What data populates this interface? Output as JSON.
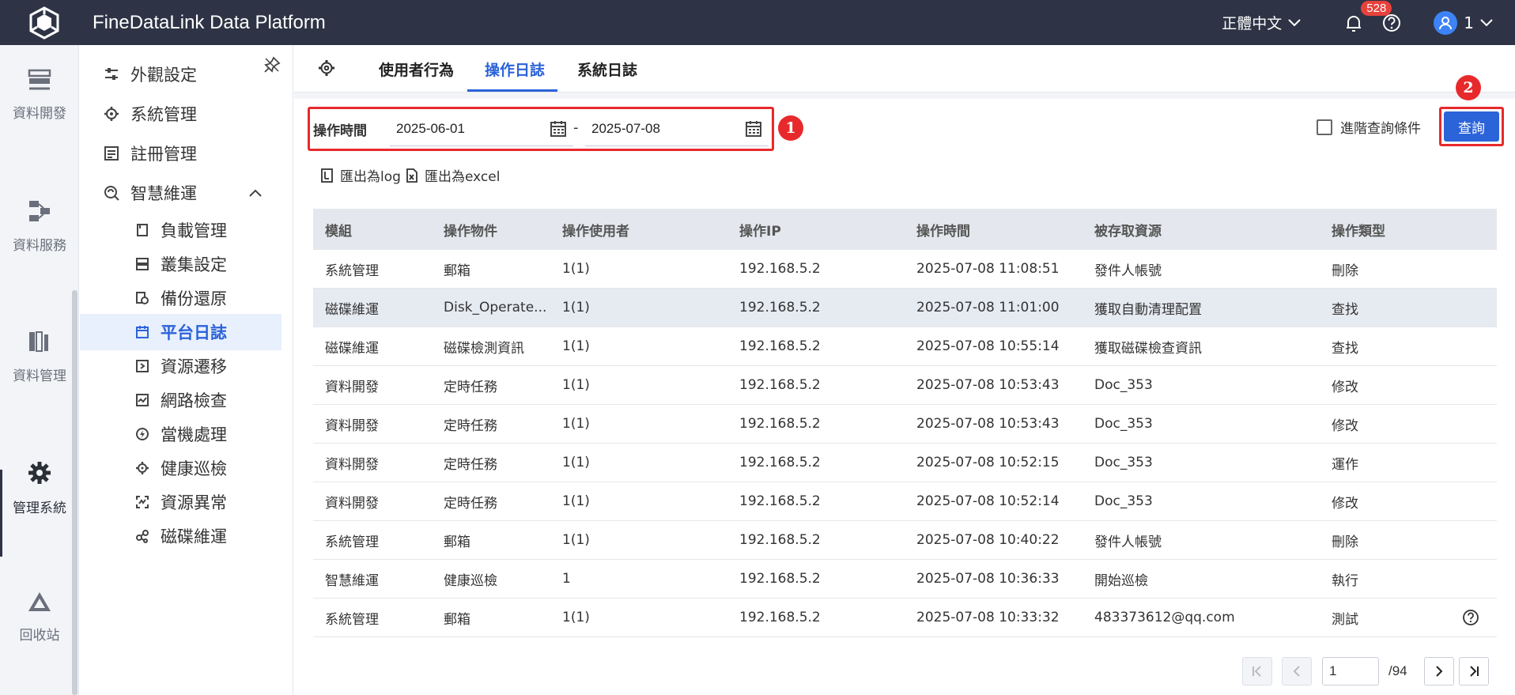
{
  "app": {
    "title": "FineDataLink Data Platform"
  },
  "topbar": {
    "language": "正體中文",
    "notification_count": "528",
    "user_name": "1"
  },
  "rail": {
    "items": [
      {
        "label": "資料開發",
        "icon": "data-dev-icon"
      },
      {
        "label": "資料服務",
        "icon": "data-service-icon"
      },
      {
        "label": "資料管理",
        "icon": "data-manage-icon"
      },
      {
        "label": "管理系統",
        "icon": "gear-icon",
        "active": true
      },
      {
        "label": "回收站",
        "icon": "recycle-icon"
      }
    ]
  },
  "sidebar": {
    "items": [
      {
        "label": "外觀設定"
      },
      {
        "label": "系統管理"
      },
      {
        "label": "註冊管理"
      },
      {
        "label": "智慧維運",
        "expanded": true
      }
    ],
    "sub_items": [
      {
        "label": "負載管理"
      },
      {
        "label": "叢集設定"
      },
      {
        "label": "備份還原"
      },
      {
        "label": "平台日誌",
        "active": true
      },
      {
        "label": "資源遷移"
      },
      {
        "label": "網路檢查"
      },
      {
        "label": "當機處理"
      },
      {
        "label": "健康巡檢"
      },
      {
        "label": "資源異常"
      },
      {
        "label": "磁碟維運"
      }
    ]
  },
  "tabs": [
    {
      "label": "使用者行為"
    },
    {
      "label": "操作日誌",
      "active": true
    },
    {
      "label": "系統日誌"
    }
  ],
  "filter": {
    "label": "操作時間",
    "start_date": "2025-06-01",
    "end_date": "2025-07-08",
    "separator": "-",
    "advanced_label": "進階查詢條件",
    "query_label": "查詢",
    "marker1": "1",
    "marker2": "2"
  },
  "exports": {
    "log_label": "匯出為log",
    "excel_label": "匯出為excel"
  },
  "table": {
    "headers": [
      "模組",
      "操作物件",
      "操作使用者",
      "操作IP",
      "操作時間",
      "被存取資源",
      "操作類型"
    ],
    "rows": [
      [
        "系統管理",
        "郵箱",
        "1(1)",
        "192.168.5.2",
        "2025-07-08 11:08:51",
        "發件人帳號",
        "刪除"
      ],
      [
        "磁碟維運",
        "Disk_Operate...",
        "1(1)",
        "192.168.5.2",
        "2025-07-08 11:01:00",
        "獲取自動清理配置",
        "查找"
      ],
      [
        "磁碟維運",
        "磁碟檢測資訊",
        "1(1)",
        "192.168.5.2",
        "2025-07-08 10:55:14",
        "獲取磁碟檢查資訊",
        "查找"
      ],
      [
        "資料開發",
        "定時任務",
        "1(1)",
        "192.168.5.2",
        "2025-07-08 10:53:43",
        "Doc_353",
        "修改"
      ],
      [
        "資料開發",
        "定時任務",
        "1(1)",
        "192.168.5.2",
        "2025-07-08 10:53:43",
        "Doc_353",
        "修改"
      ],
      [
        "資料開發",
        "定時任務",
        "1(1)",
        "192.168.5.2",
        "2025-07-08 10:52:15",
        "Doc_353",
        "運作"
      ],
      [
        "資料開發",
        "定時任務",
        "1(1)",
        "192.168.5.2",
        "2025-07-08 10:52:14",
        "Doc_353",
        "修改"
      ],
      [
        "系統管理",
        "郵箱",
        "1(1)",
        "192.168.5.2",
        "2025-07-08 10:40:22",
        "發件人帳號",
        "刪除"
      ],
      [
        "智慧維運",
        "健康巡檢",
        "1",
        "192.168.5.2",
        "2025-07-08 10:36:33",
        "開始巡檢",
        "執行"
      ],
      [
        "系統管理",
        "郵箱",
        "1(1)",
        "192.168.5.2",
        "2025-07-08 10:33:32",
        "483373612@qq.com",
        "測試"
      ]
    ]
  },
  "pagination": {
    "current_page": "1",
    "total_pages": "/94"
  },
  "colors": {
    "topbar": "#2e3445",
    "accent": "#2b63d9",
    "highlight": "#e8292b"
  }
}
